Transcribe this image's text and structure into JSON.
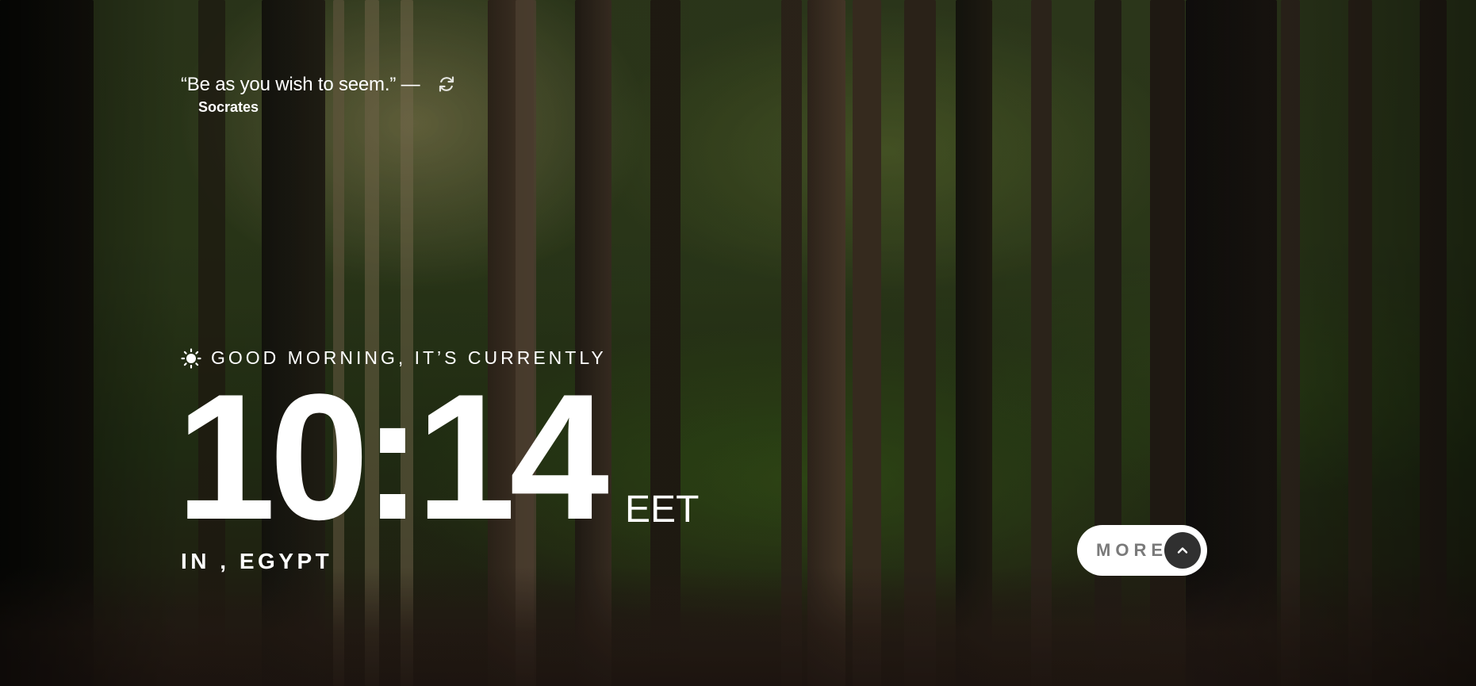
{
  "quote": {
    "text": "“Be as you wish to seem.” —",
    "author": "Socrates",
    "refresh_icon": "refresh-icon"
  },
  "greeting": {
    "icon": "sun-icon",
    "text": "GOOD MORNING, IT’S CURRENTLY"
  },
  "clock": {
    "time": "10:14",
    "timezone": "EET"
  },
  "location": {
    "text": "IN , EGYPT"
  },
  "more_button": {
    "label": "MORE",
    "icon": "chevron-up-icon"
  },
  "colors": {
    "text": "#ffffff",
    "button_bg": "#ffffff",
    "button_text": "#7a7a7a",
    "arrow_bg": "#303030"
  }
}
